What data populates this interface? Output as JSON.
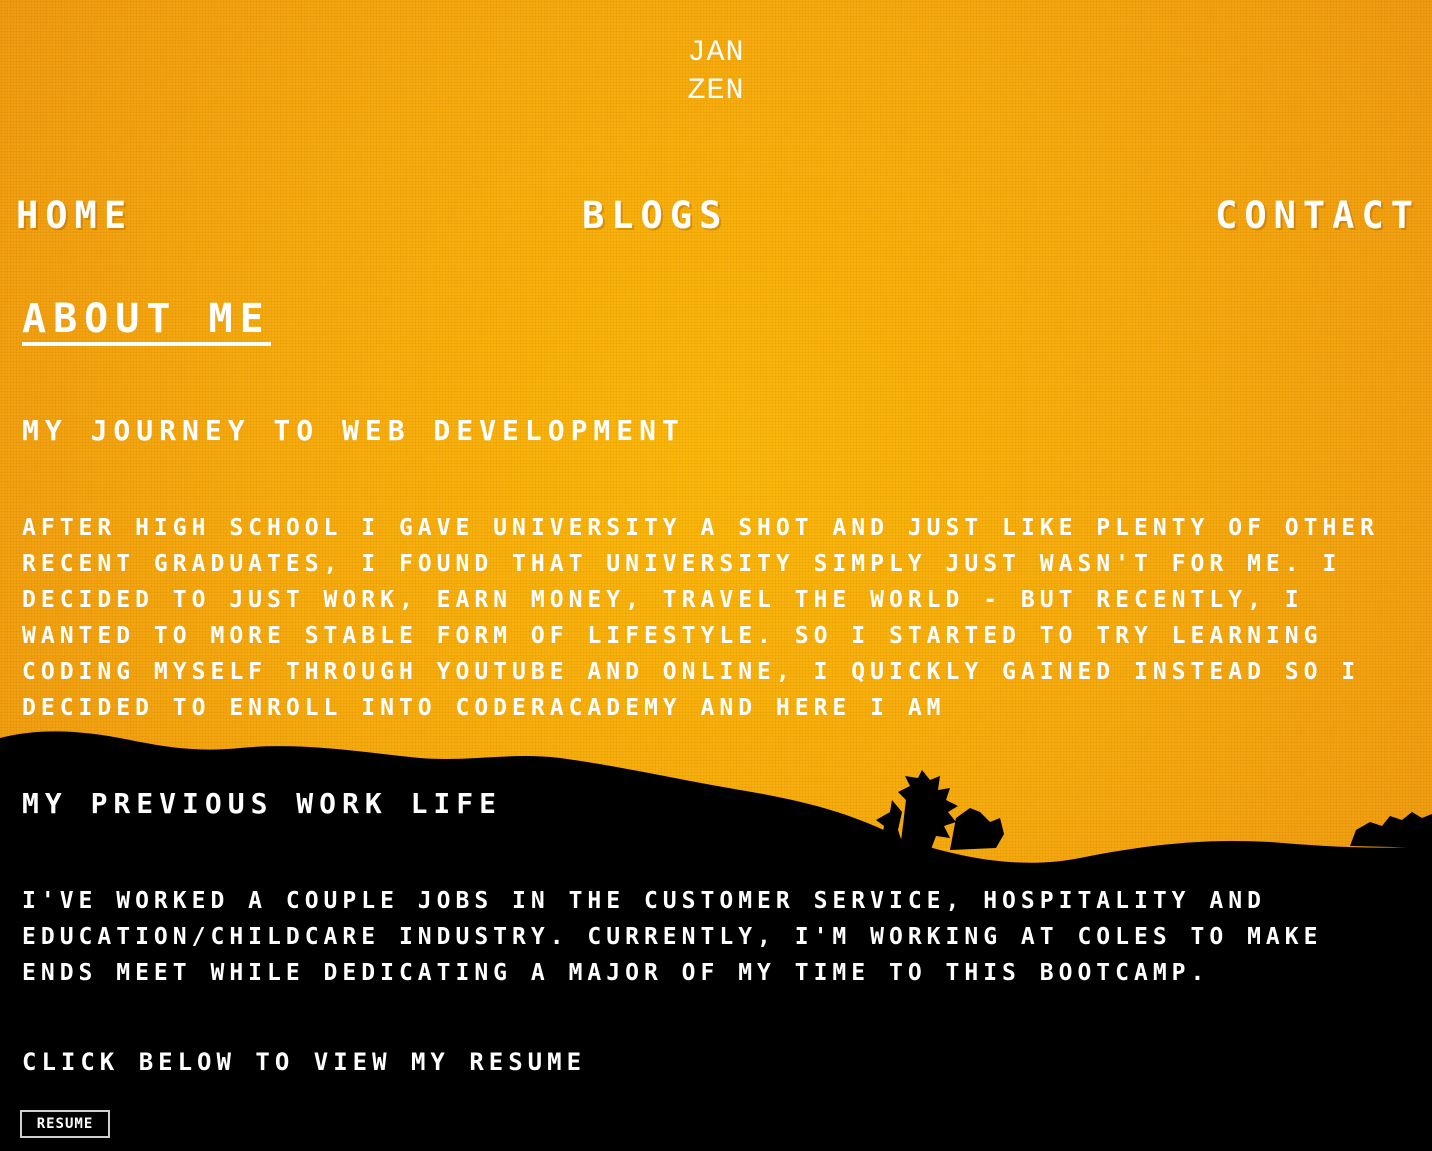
{
  "logo": {
    "line1": "JAN",
    "line2": "ZEN"
  },
  "nav": {
    "home": "Home",
    "blogs": "Blogs",
    "contact": "Contact"
  },
  "about": {
    "title": "About Me",
    "journey_heading": "My Journey to web development",
    "journey_text": "After high school I gave university a shot and just like plenty of other recent graduates, I found that university simply just wasn't for me. I decided to just work, earn money, travel the world - but recently, I wanted to more stable form of lifestyle. So I started to try learning coding myself through youtube and online, I quickly gained instead so I decided to enroll into CoderAcademy and here I am",
    "work_heading": "My previous work life",
    "work_text": "I've worked a couple jobs in the customer service, hospitality and education/childcare industry. Currently, I'm working at Coles to make ends meet while dedicating a major of my time to this bootcamp.",
    "cta": "Click below to view my resume",
    "resume_button": "Resume"
  },
  "colors": {
    "sky": "#f6aa0c",
    "silhouette": "#000000",
    "text": "#ffffff"
  }
}
